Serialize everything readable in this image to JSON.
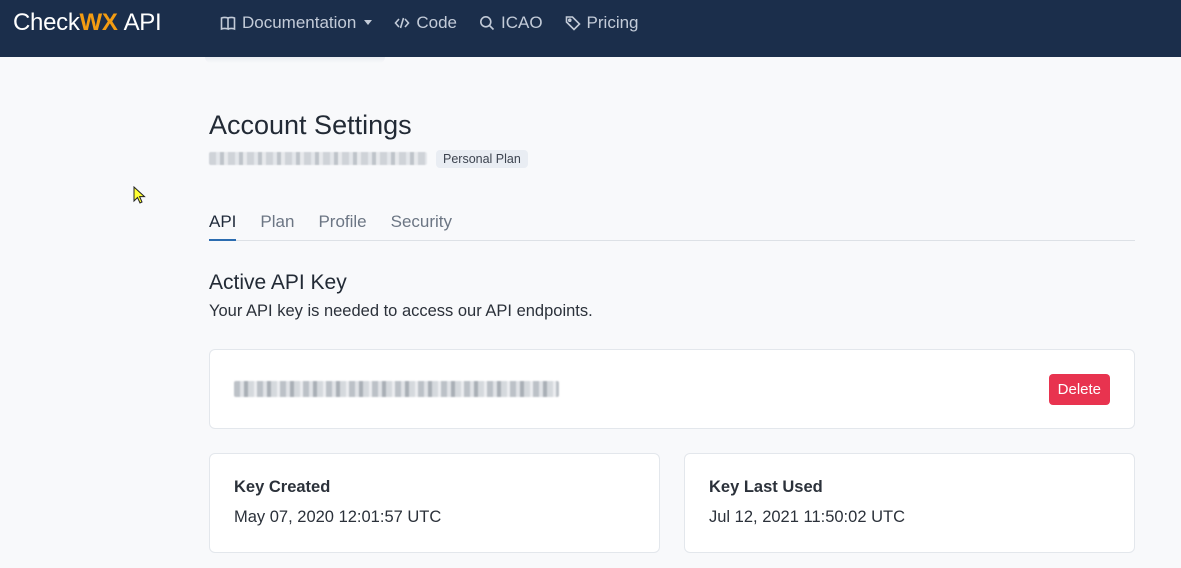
{
  "brand": {
    "check": "Check",
    "wx": "WX",
    "api": "API"
  },
  "nav": [
    {
      "label": "Documentation",
      "icon": "book-icon",
      "dropdown": true
    },
    {
      "label": "Code",
      "icon": "code-icon"
    },
    {
      "label": "ICAO",
      "icon": "search-icon"
    },
    {
      "label": "Pricing",
      "icon": "tag-icon"
    }
  ],
  "page": {
    "title": "Account Settings",
    "plan_badge": "Personal Plan"
  },
  "tabs": [
    "API",
    "Plan",
    "Profile",
    "Security"
  ],
  "active_tab": "API",
  "api_section": {
    "title": "Active API Key",
    "description": "Your API key is needed to access our API endpoints.",
    "delete_label": "Delete"
  },
  "key_created": {
    "label": "Key Created",
    "value": "May 07, 2020 12:01:57 UTC"
  },
  "key_last_used": {
    "label": "Key Last Used",
    "value": "Jul 12, 2021 11:50:02 UTC"
  },
  "colors": {
    "navbar": "#1b2e4b",
    "accent": "#f39c12",
    "danger": "#e8334f",
    "active_tab": "#2b6cb0"
  }
}
